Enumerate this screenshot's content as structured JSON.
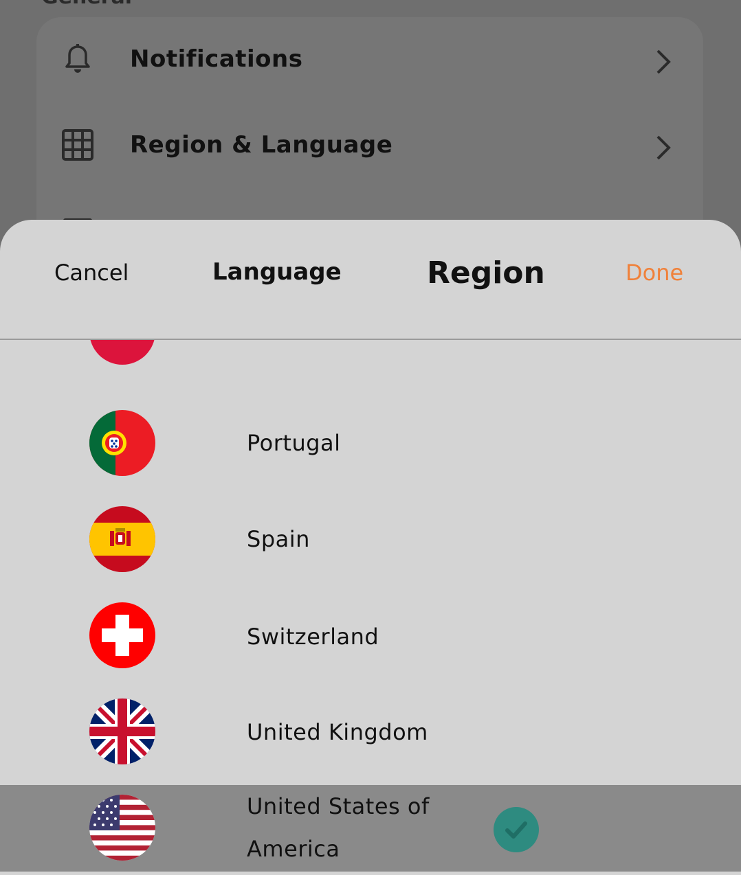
{
  "background": {
    "section_header": "General",
    "items": [
      {
        "label": "Notifications",
        "icon": "bell-icon"
      },
      {
        "label": "Region & Language",
        "icon": "grid-icon"
      },
      {
        "label": "",
        "icon": "calendar-icon"
      }
    ]
  },
  "sheet": {
    "cancel_label": "Cancel",
    "tabs": [
      {
        "label": "Language",
        "active": false
      },
      {
        "label": "Region",
        "active": true
      }
    ],
    "done_label": "Done",
    "colors": {
      "accent": "#f0813a",
      "selected_row": "#8a8a8a",
      "check": "#2e8b80"
    },
    "countries": [
      {
        "name": "",
        "flag": "partial-flag-icon",
        "selected": false
      },
      {
        "name": "Portugal",
        "flag": "portugal-flag-icon",
        "selected": false
      },
      {
        "name": "Spain",
        "flag": "spain-flag-icon",
        "selected": false
      },
      {
        "name": "Switzerland",
        "flag": "switzerland-flag-icon",
        "selected": false
      },
      {
        "name": "United Kingdom",
        "flag": "uk-flag-icon",
        "selected": false
      },
      {
        "name": "United States of America",
        "flag": "usa-flag-icon",
        "selected": true
      }
    ]
  }
}
